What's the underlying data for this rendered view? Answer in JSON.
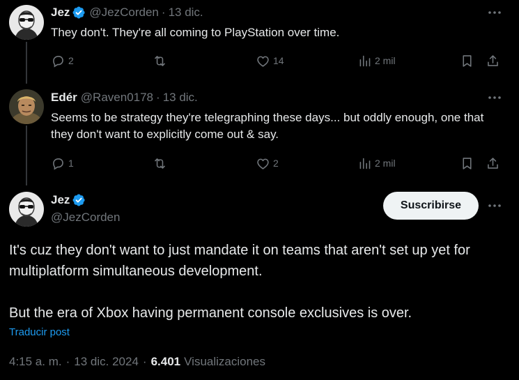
{
  "colors": {
    "background": "#000000",
    "text": "#e7e9ea",
    "muted": "#71767b",
    "accent": "#1d9bf0",
    "button_bg": "#eff3f4"
  },
  "reply1": {
    "name": "Jez",
    "handle": "@JezCorden",
    "separator": "·",
    "date": "13 dic.",
    "text": "They don't. They're all coming to PlayStation over time.",
    "replies": "2",
    "reposts": "",
    "likes": "14",
    "views": "2 mil"
  },
  "reply2": {
    "name": "Edér",
    "handle": "@Raven0178",
    "separator": "·",
    "date": "13 dic.",
    "text": "Seems to be strategy they're telegraphing these days... but oddly enough, one that they don't want to explicitly come out & say.",
    "replies": "1",
    "reposts": "",
    "likes": "2",
    "views": "2 mil"
  },
  "main": {
    "name": "Jez",
    "handle": "@JezCorden",
    "subscribe_label": "Suscribirse",
    "paragraph1": "It's cuz they don't want to just mandate it on teams that aren't set up yet for multiplatform simultaneous development.",
    "paragraph2": "But the era of Xbox having permanent console exclusives is over.",
    "translate_label": "Traducir post",
    "time": "4:15 a. m.",
    "separator": "·",
    "date": "13 dic. 2024",
    "views_count": "6.401",
    "views_label": "Visualizaciones"
  },
  "icons": [
    "verified-badge-icon",
    "more-icon",
    "reply-icon",
    "repost-icon",
    "like-icon",
    "views-icon",
    "bookmark-icon",
    "share-icon"
  ]
}
